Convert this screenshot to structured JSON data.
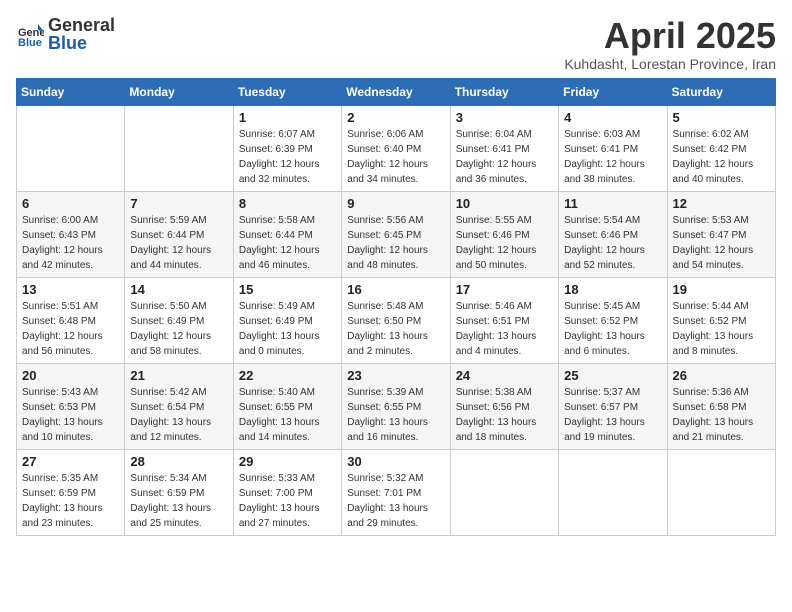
{
  "header": {
    "logo_general": "General",
    "logo_blue": "Blue",
    "title": "April 2025",
    "subtitle": "Kuhdasht, Lorestan Province, Iran"
  },
  "weekdays": [
    "Sunday",
    "Monday",
    "Tuesday",
    "Wednesday",
    "Thursday",
    "Friday",
    "Saturday"
  ],
  "weeks": [
    {
      "days": [
        {
          "num": "",
          "info": ""
        },
        {
          "num": "",
          "info": ""
        },
        {
          "num": "1",
          "info": "Sunrise: 6:07 AM\nSunset: 6:39 PM\nDaylight: 12 hours\nand 32 minutes."
        },
        {
          "num": "2",
          "info": "Sunrise: 6:06 AM\nSunset: 6:40 PM\nDaylight: 12 hours\nand 34 minutes."
        },
        {
          "num": "3",
          "info": "Sunrise: 6:04 AM\nSunset: 6:41 PM\nDaylight: 12 hours\nand 36 minutes."
        },
        {
          "num": "4",
          "info": "Sunrise: 6:03 AM\nSunset: 6:41 PM\nDaylight: 12 hours\nand 38 minutes."
        },
        {
          "num": "5",
          "info": "Sunrise: 6:02 AM\nSunset: 6:42 PM\nDaylight: 12 hours\nand 40 minutes."
        }
      ]
    },
    {
      "days": [
        {
          "num": "6",
          "info": "Sunrise: 6:00 AM\nSunset: 6:43 PM\nDaylight: 12 hours\nand 42 minutes."
        },
        {
          "num": "7",
          "info": "Sunrise: 5:59 AM\nSunset: 6:44 PM\nDaylight: 12 hours\nand 44 minutes."
        },
        {
          "num": "8",
          "info": "Sunrise: 5:58 AM\nSunset: 6:44 PM\nDaylight: 12 hours\nand 46 minutes."
        },
        {
          "num": "9",
          "info": "Sunrise: 5:56 AM\nSunset: 6:45 PM\nDaylight: 12 hours\nand 48 minutes."
        },
        {
          "num": "10",
          "info": "Sunrise: 5:55 AM\nSunset: 6:46 PM\nDaylight: 12 hours\nand 50 minutes."
        },
        {
          "num": "11",
          "info": "Sunrise: 5:54 AM\nSunset: 6:46 PM\nDaylight: 12 hours\nand 52 minutes."
        },
        {
          "num": "12",
          "info": "Sunrise: 5:53 AM\nSunset: 6:47 PM\nDaylight: 12 hours\nand 54 minutes."
        }
      ]
    },
    {
      "days": [
        {
          "num": "13",
          "info": "Sunrise: 5:51 AM\nSunset: 6:48 PM\nDaylight: 12 hours\nand 56 minutes."
        },
        {
          "num": "14",
          "info": "Sunrise: 5:50 AM\nSunset: 6:49 PM\nDaylight: 12 hours\nand 58 minutes."
        },
        {
          "num": "15",
          "info": "Sunrise: 5:49 AM\nSunset: 6:49 PM\nDaylight: 13 hours\nand 0 minutes."
        },
        {
          "num": "16",
          "info": "Sunrise: 5:48 AM\nSunset: 6:50 PM\nDaylight: 13 hours\nand 2 minutes."
        },
        {
          "num": "17",
          "info": "Sunrise: 5:46 AM\nSunset: 6:51 PM\nDaylight: 13 hours\nand 4 minutes."
        },
        {
          "num": "18",
          "info": "Sunrise: 5:45 AM\nSunset: 6:52 PM\nDaylight: 13 hours\nand 6 minutes."
        },
        {
          "num": "19",
          "info": "Sunrise: 5:44 AM\nSunset: 6:52 PM\nDaylight: 13 hours\nand 8 minutes."
        }
      ]
    },
    {
      "days": [
        {
          "num": "20",
          "info": "Sunrise: 5:43 AM\nSunset: 6:53 PM\nDaylight: 13 hours\nand 10 minutes."
        },
        {
          "num": "21",
          "info": "Sunrise: 5:42 AM\nSunset: 6:54 PM\nDaylight: 13 hours\nand 12 minutes."
        },
        {
          "num": "22",
          "info": "Sunrise: 5:40 AM\nSunset: 6:55 PM\nDaylight: 13 hours\nand 14 minutes."
        },
        {
          "num": "23",
          "info": "Sunrise: 5:39 AM\nSunset: 6:55 PM\nDaylight: 13 hours\nand 16 minutes."
        },
        {
          "num": "24",
          "info": "Sunrise: 5:38 AM\nSunset: 6:56 PM\nDaylight: 13 hours\nand 18 minutes."
        },
        {
          "num": "25",
          "info": "Sunrise: 5:37 AM\nSunset: 6:57 PM\nDaylight: 13 hours\nand 19 minutes."
        },
        {
          "num": "26",
          "info": "Sunrise: 5:36 AM\nSunset: 6:58 PM\nDaylight: 13 hours\nand 21 minutes."
        }
      ]
    },
    {
      "days": [
        {
          "num": "27",
          "info": "Sunrise: 5:35 AM\nSunset: 6:59 PM\nDaylight: 13 hours\nand 23 minutes."
        },
        {
          "num": "28",
          "info": "Sunrise: 5:34 AM\nSunset: 6:59 PM\nDaylight: 13 hours\nand 25 minutes."
        },
        {
          "num": "29",
          "info": "Sunrise: 5:33 AM\nSunset: 7:00 PM\nDaylight: 13 hours\nand 27 minutes."
        },
        {
          "num": "30",
          "info": "Sunrise: 5:32 AM\nSunset: 7:01 PM\nDaylight: 13 hours\nand 29 minutes."
        },
        {
          "num": "",
          "info": ""
        },
        {
          "num": "",
          "info": ""
        },
        {
          "num": "",
          "info": ""
        }
      ]
    }
  ]
}
